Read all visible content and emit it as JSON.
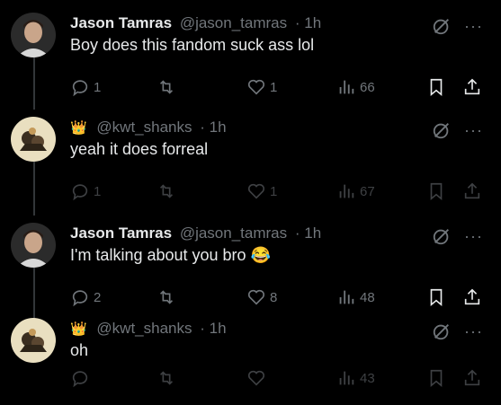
{
  "tweets": [
    {
      "name": "Jason Tamras",
      "handle": "@jason_tamras",
      "time": "· 1h",
      "text": "Boy does this fandom suck ass lol",
      "emoji": "",
      "avatar": "person",
      "replies": "1",
      "reposts": "",
      "likes": "1",
      "views": "66"
    },
    {
      "name": "",
      "handle": "@kwt_shanks",
      "time": "· 1h",
      "text": "yeah it does forreal",
      "emoji": "",
      "avatar": "anime",
      "replies": "1",
      "reposts": "",
      "likes": "1",
      "views": "67"
    },
    {
      "name": "Jason Tamras",
      "handle": "@jason_tamras",
      "time": "· 1h",
      "text": "I'm talking about you bro",
      "emoji": "😂",
      "avatar": "person",
      "replies": "2",
      "reposts": "",
      "likes": "8",
      "views": "48"
    },
    {
      "name": "",
      "handle": "@kwt_shanks",
      "time": "· 1h",
      "text": "oh",
      "emoji": "",
      "avatar": "anime",
      "replies": "",
      "reposts": "",
      "likes": "",
      "views": "43"
    }
  ],
  "more_glyph": "···",
  "crown_glyph": "👑",
  "colors": {
    "background": "#000000",
    "text": "#e7e9ea",
    "muted": "#71767b",
    "thread_line": "#333639"
  }
}
